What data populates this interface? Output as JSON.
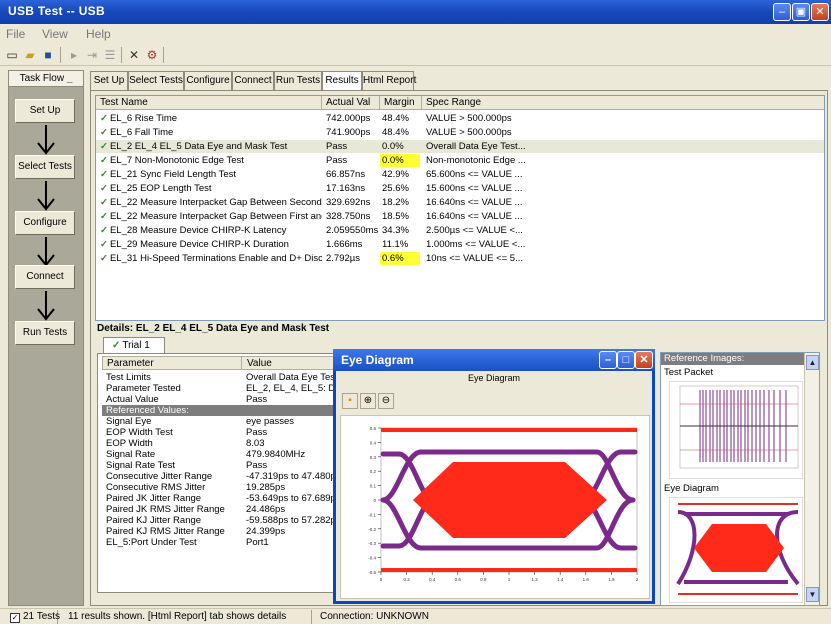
{
  "window": {
    "title": "USB Test -- USB"
  },
  "menu": [
    "File",
    "View",
    "Help"
  ],
  "task_flow": {
    "header": "Task Flow",
    "steps": [
      "Set Up",
      "Select Tests",
      "Configure",
      "Connect",
      "Run Tests"
    ]
  },
  "tabs": [
    "Set Up",
    "Select Tests",
    "Configure",
    "Connect",
    "Run Tests",
    "Results",
    "Html Report"
  ],
  "active_tab": "Results",
  "results": {
    "columns": [
      "Test Name",
      "Actual Val",
      "Margin",
      "Spec Range"
    ],
    "rows": [
      {
        "name": "EL_6 Rise Time",
        "actual": "742.000ps",
        "margin": "48.4%",
        "spec": "VALUE > 500.000ps",
        "highlight": false,
        "selected": false
      },
      {
        "name": "EL_6 Fall Time",
        "actual": "741.900ps",
        "margin": "48.4%",
        "spec": "VALUE > 500.000ps",
        "highlight": false,
        "selected": false
      },
      {
        "name": "EL_2 EL_4 EL_5 Data Eye and Mask Test",
        "actual": "Pass",
        "margin": "0.0%",
        "spec": "Overall Data Eye Test...",
        "highlight": false,
        "selected": true
      },
      {
        "name": "EL_7 Non-Monotonic Edge Test",
        "actual": "Pass",
        "margin": "0.0%",
        "spec": "Non-monotonic Edge ...",
        "highlight": true,
        "selected": false
      },
      {
        "name": "EL_21 Sync Field Length Test",
        "actual": "66.857ns",
        "margin": "42.9%",
        "spec": "65.600ns <= VALUE ...",
        "highlight": false,
        "selected": false
      },
      {
        "name": "EL_25 EOP Length Test",
        "actual": "17.163ns",
        "margin": "25.6%",
        "spec": "15.600ns <= VALUE ...",
        "highlight": false,
        "selected": false
      },
      {
        "name": "EL_22 Measure Interpacket Gap Between Second ...",
        "actual": "329.692ns",
        "margin": "18.2%",
        "spec": "16.640ns <= VALUE ...",
        "highlight": false,
        "selected": false
      },
      {
        "name": "EL_22 Measure Interpacket Gap Between First and...",
        "actual": "328.750ns",
        "margin": "18.5%",
        "spec": "16.640ns <= VALUE ...",
        "highlight": false,
        "selected": false
      },
      {
        "name": "EL_28 Measure Device CHIRP-K Latency",
        "actual": "2.059550ms",
        "margin": "34.3%",
        "spec": "2.500µs <= VALUE <...",
        "highlight": false,
        "selected": false
      },
      {
        "name": "EL_29 Measure Device CHIRP-K Duration",
        "actual": "1.666ms",
        "margin": "11.1%",
        "spec": "1.000ms <= VALUE <...",
        "highlight": false,
        "selected": false
      },
      {
        "name": "EL_31 Hi-Speed Terminations Enable and D+ Disco...",
        "actual": "2.792µs",
        "margin": "0.6%",
        "spec": "10ns <= VALUE <= 5...",
        "highlight": true,
        "selected": false
      }
    ]
  },
  "details": {
    "title": "Details: EL_2 EL_4 EL_5 Data Eye and Mask Test",
    "trial_tab": "Trial 1",
    "columns": [
      "Parameter",
      "Value"
    ],
    "rows": [
      {
        "p": "Test Limits",
        "v": "Overall Data Eye Test -"
      },
      {
        "p": "Parameter Tested",
        "v": "EL_2, EL_4, EL_5: Devi"
      },
      {
        "p": "Actual Value",
        "v": "Pass"
      },
      {
        "p": "Referenced Values:",
        "v": "",
        "band": true
      },
      {
        "p": "Signal Eye",
        "v": "eye passes"
      },
      {
        "p": "EOP Width Test",
        "v": "Pass"
      },
      {
        "p": "EOP Width",
        "v": "8.03"
      },
      {
        "p": "Signal Rate",
        "v": "479.9840MHz"
      },
      {
        "p": "Signal Rate Test",
        "v": "Pass"
      },
      {
        "p": "Consecutive Jitter Range",
        "v": "-47.319ps to 47.480ps"
      },
      {
        "p": "Consecutive RMS Jitter",
        "v": "19.285ps"
      },
      {
        "p": "Paired JK Jitter Range",
        "v": "-53.649ps to 67.689ps"
      },
      {
        "p": "Paired JK RMS Jitter Range",
        "v": "24.486ps"
      },
      {
        "p": "Paired KJ Jitter Range",
        "v": "-59.588ps to 57.282ps"
      },
      {
        "p": "Paired KJ RMS Jitter Range",
        "v": "24.399ps"
      },
      {
        "p": "EL_5:Port Under Test",
        "v": "Port1"
      }
    ]
  },
  "eye_window": {
    "title": "Eye Diagram",
    "plot_title": "Eye Diagram",
    "y_ticks": [
      "0.5",
      "0.4",
      "0.3",
      "0.2",
      "0.1",
      "0",
      "-0.1",
      "-0.2",
      "-0.3",
      "-0.4",
      "-0.5"
    ],
    "x_ticks": [
      "0",
      "0.2",
      "0.4",
      "0.6",
      "0.8",
      "1",
      "1.2",
      "1.4",
      "1.6",
      "1.8",
      "2"
    ],
    "colors": {
      "trace": "#7b2a8c",
      "mask": "#ff2a1a"
    }
  },
  "reference_images": {
    "header": "Reference Images:",
    "labels": [
      "Test Packet",
      "Eye Diagram"
    ]
  },
  "status": {
    "tests_checkbox": "21 Tests",
    "message": "11 results shown. [Html Report] tab shows details",
    "connection": "Connection: UNKNOWN"
  }
}
